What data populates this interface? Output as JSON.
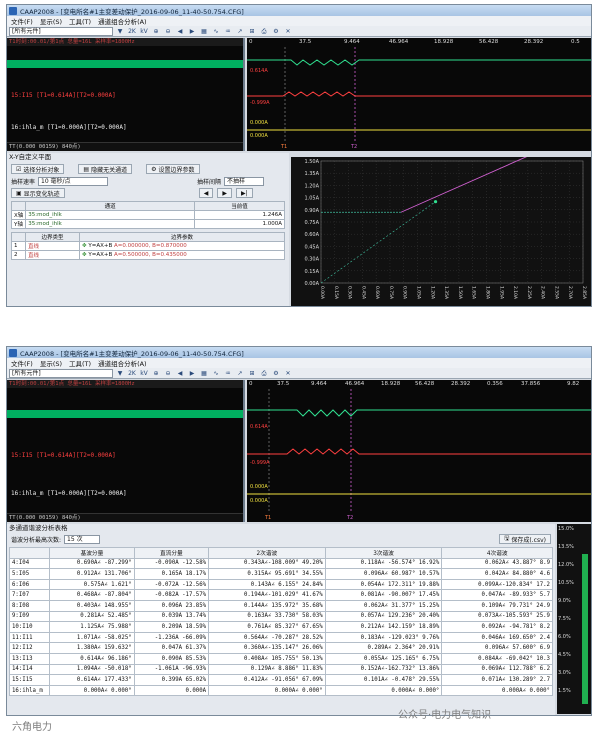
{
  "screenshot1": {
    "window_title": "CAAP2008 - [变电所名#1主变差动保护_2016-09-06_11-40-50.754.CFG]",
    "menu": [
      "文件(F)",
      "显示(S)",
      "工具(T)",
      "通道组合分析(A)"
    ],
    "channel_combo": "[所有元件]",
    "toolbar_tokens": [
      "2K",
      "kV"
    ],
    "info_bar": "T1时刻:00.01/第1点 总量=16L 采样率=1800Hz",
    "time_ticks": [
      "0",
      "37.5",
      "9.464",
      "46.964",
      "18.928",
      "56.428",
      "28.392",
      "0.5"
    ],
    "channels": [
      {
        "label": "15:I15 [T1=0.614A][T2=0.000A]",
        "color": "#ff4040"
      },
      {
        "label": "16:ihla_m [T1=0.000A][T2=0.000A]",
        "color": "#f0f0f0"
      }
    ],
    "wave_values": [
      {
        "text": "0.614A",
        "color": "#ff4040"
      },
      {
        "text": "-0.999A",
        "color": "#ff4040"
      },
      {
        "text": "0.000A",
        "color": "#f0e040"
      },
      {
        "text": "0.000A",
        "color": "#f0e040"
      }
    ],
    "cursor_labels": [
      "T1",
      "T2"
    ],
    "status": "TT(0.000 00159) 840点)",
    "xy_panel": {
      "title": "X-Y自定义平面",
      "buttons": [
        "选择分析对象",
        "隐藏无关通道",
        "设置边界参数"
      ],
      "rate_label": "抽样速率",
      "rate_value": "10 毫秒/点",
      "sample_label": "抽样间隔",
      "sample_value": "不抽样",
      "show_trace": "显示变化轨迹",
      "channel_headers": [
        "通道",
        "当前值"
      ],
      "channels": [
        {
          "axis": "X轴",
          "name": "35:mod_ihlk",
          "value": "1.246A"
        },
        {
          "axis": "Y轴",
          "name": "35:mod_ihlk",
          "value": "1.000A"
        }
      ],
      "boundary_headers": [
        "边界类型",
        "边界参数"
      ],
      "boundaries": [
        {
          "index": "1",
          "type": "直线",
          "formula": "Y=AX+B",
          "params": "A=0.000000, B=0.870000"
        },
        {
          "index": "2",
          "type": "直线",
          "formula": "Y=AX+B",
          "params": "A=0.500000, B=0.435000"
        }
      ]
    },
    "xy_chart": {
      "y_ticks": [
        "1.50A",
        "1.35A",
        "1.20A",
        "1.05A",
        "0.90A",
        "0.75A",
        "0.60A",
        "0.45A",
        "0.30A",
        "0.15A",
        "0.00A"
      ],
      "x_ticks": [
        "0.00A",
        "0.15A",
        "0.30A",
        "0.45A",
        "0.60A",
        "0.75A",
        "0.90A",
        "1.05A",
        "1.20A",
        "1.35A",
        "1.50A",
        "1.65A",
        "1.80A",
        "1.95A",
        "2.10A",
        "2.25A",
        "2.40A",
        "2.55A",
        "2.70A",
        "2.85A"
      ]
    }
  },
  "screenshot2": {
    "window_title": "CAAP2008 - [变电所名#1主变差动保护_2016-09-06_11-40-50.754.CFG]",
    "menu": [
      "文件(F)",
      "显示(S)",
      "工具(T)",
      "通道组合分析(A)"
    ],
    "channel_combo": "[所有元件]",
    "toolbar_tokens": [
      "2K",
      "kV"
    ],
    "info_bar": "T1时刻:00.01/第1点 总量=16L 采样率=1800Hz",
    "time_ticks": [
      "0",
      "37.5",
      "9.464",
      "46.964",
      "18.928",
      "56.428",
      "28.392",
      "0.356",
      "37.856",
      "9.82"
    ],
    "channels": [
      {
        "label": "15:I15 [T1=0.614A][T2=0.000A]",
        "color": "#ff4040"
      },
      {
        "label": "16:ihla_m [T1=0.000A][T2=0.000A]",
        "color": "#f0f0f0"
      }
    ],
    "wave_values": [
      {
        "text": "0.614A",
        "color": "#ff4040"
      },
      {
        "text": "-0.999A",
        "color": "#ff4040"
      },
      {
        "text": "0.000A",
        "color": "#f0e040"
      },
      {
        "text": "0.000A",
        "color": "#f0e040"
      }
    ],
    "cursor_labels": [
      "T1",
      "T2"
    ],
    "status": "TT(0.000 00159) 840点)",
    "harmonic_panel": {
      "title": "多通道谐波分析表格",
      "count_label": "谐波分析最高次数:",
      "count_value": "15 次",
      "save_button": "保存成(.csv)",
      "headers": [
        "",
        "基波分量",
        "直流分量",
        "2次谐波",
        "3次谐波",
        "4次谐波"
      ],
      "rows": [
        [
          "4:I04",
          "0.690A∠ -87.299°",
          "-0.090A -12.58%",
          "0.343A∠-108.009° 49.20%",
          "0.118A∠ -56.574° 16.92%",
          "0.062A∠ 43.887° 8.9"
        ],
        [
          "5:I05",
          "0.912A∠ 131.706°",
          "0.165A 18.17%",
          "0.315A∠ 95.691° 34.55%",
          "0.096A∠ 60.987° 10.57%",
          "0.042A∠ 84.880° 4.6"
        ],
        [
          "6:I06",
          "0.575A∠ 1.621°",
          "-0.072A -12.56%",
          "0.143A∠ 6.155° 24.84%",
          "0.054A∠ 172.311° 19.88%",
          "0.099A∠-120.834° 17.2"
        ],
        [
          "7:I07",
          "0.468A∠ -87.804°",
          "-0.082A -17.57%",
          "0.194A∠-101.029° 41.67%",
          "0.081A∠ -90.007° 17.45%",
          "0.047A∠ -89.933° 5.7"
        ],
        [
          "8:I08",
          "0.403A∠ 148.955°",
          "0.096A 23.85%",
          "0.144A∠ 135.972° 35.68%",
          "0.062A∠ 31.377° 15.25%",
          "0.109A∠ 79.731° 24.9"
        ],
        [
          "9:I09",
          "0.281A∠ 52.485°",
          "0.039A 13.74%",
          "0.163A∠ 33.730° 58.03%",
          "0.057A∠ 129.236° 20.40%",
          "0.073A∠-105.593° 25.9"
        ],
        [
          "10:I10",
          "1.125A∠ 75.988°",
          "0.209A 18.59%",
          "0.761A∠ 85.327° 67.65%",
          "0.212A∠ 142.159° 18.89%",
          "0.092A∠ -94.781° 8.2"
        ],
        [
          "11:I11",
          "1.071A∠ -58.025°",
          "-1.236A -66.09%",
          "0.564A∠ -70.287° 28.52%",
          "0.183A∠ -129.023° 9.76%",
          "0.046A∠ 169.650° 2.4"
        ],
        [
          "12:I12",
          "1.380A∠ 159.632°",
          "0.047A 61.37%",
          "0.360A∠-135.147° 26.06%",
          "0.289A∠ 2.364° 20.91%",
          "0.096A∠ 57.600° 6.9"
        ],
        [
          "13:I13",
          "0.614A∠ 96.186°",
          "0.090A 85.53%",
          "0.408A∠ 105.755° 50.13%",
          "0.055A∠ 125.165° 6.75%",
          "0.084A∠ -69.042° 10.3"
        ],
        [
          "14:I14",
          "1.094A∠ -50.018°",
          "-1.061A -96.93%",
          "0.129A∠ 8.886° 11.83%",
          "0.152A∠-162.732° 13.86%",
          "0.069A∠ 112.788° 6.2"
        ],
        [
          "15:I15",
          "0.614A∠ 177.433°",
          "0.399A 65.02%",
          "0.412A∠ -91.056° 67.09%",
          "0.101A∠ -0.478° 29.55%",
          "0.071A∠ 130.289° 2.7"
        ],
        [
          "16:ihla_m",
          "0.000A∠ 0.000°",
          "0.000A",
          "0.000A∠ 0.000°",
          "0.000A∠ 0.000°",
          "0.000A∠ 0.000°"
        ]
      ],
      "side_scale": [
        "15.0%",
        "13.5%",
        "12.0%",
        "10.5%",
        "9.0%",
        "7.5%",
        "6.0%",
        "4.5%",
        "3.0%",
        "1.5%"
      ]
    }
  },
  "watermarks": {
    "left": "六角电力",
    "right": "公众号·电力电气知识"
  }
}
